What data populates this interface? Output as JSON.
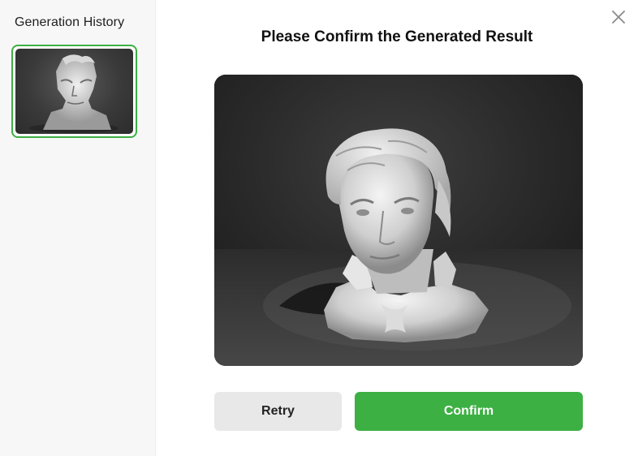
{
  "sidebar": {
    "title": "Generation History",
    "items": [
      {
        "selected": true,
        "image": "bust-thumbnail"
      }
    ]
  },
  "dialog": {
    "title": "Please Confirm the Generated Result",
    "close_icon": "close-icon",
    "preview_image": "generated-3d-bust-render"
  },
  "actions": {
    "retry_label": "Retry",
    "confirm_label": "Confirm"
  },
  "colors": {
    "accent": "#3cb043",
    "retry_bg": "#e8e8e8",
    "sidebar_bg": "#f7f7f7"
  }
}
